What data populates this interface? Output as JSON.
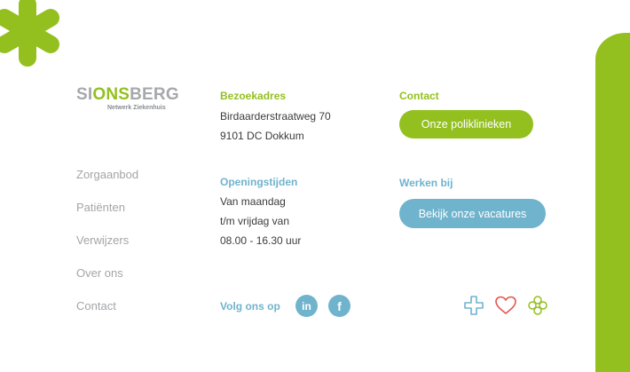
{
  "brand": {
    "name_part1": "SI",
    "name_part2": "ONS",
    "name_part3": "BERG",
    "tagline": "Netwerk Ziekenhuis",
    "colors": {
      "green": "#93c01f",
      "blue": "#70b3cd",
      "gray": "#a6a8ab"
    }
  },
  "nav": {
    "items": [
      {
        "label": "Zorgaanbod"
      },
      {
        "label": "Patiënten"
      },
      {
        "label": "Verwijzers"
      },
      {
        "label": "Over ons"
      },
      {
        "label": "Contact"
      }
    ]
  },
  "address": {
    "heading": "Bezoekadres",
    "street": "Birdaarderstraatweg 70",
    "city": "9101 DC Dokkum"
  },
  "hours": {
    "heading": "Openingstijden",
    "line1": "Van maandag",
    "line2": "t/m vrijdag van",
    "line3": "08.00 - 16.30 uur"
  },
  "contact": {
    "heading": "Contact",
    "button_label": "Onze poliklinieken"
  },
  "jobs": {
    "heading": "Werken bij",
    "button_label": "Bekijk onze vacatures"
  },
  "social": {
    "label": "Volg ons op",
    "linkedin_text": "in",
    "facebook_text": "f",
    "icons": [
      "linkedin-icon",
      "facebook-icon"
    ]
  },
  "decorative_icons": [
    "green-asterisk-icon",
    "plus-outline-icon",
    "heart-outline-icon",
    "clover-outline-icon"
  ]
}
